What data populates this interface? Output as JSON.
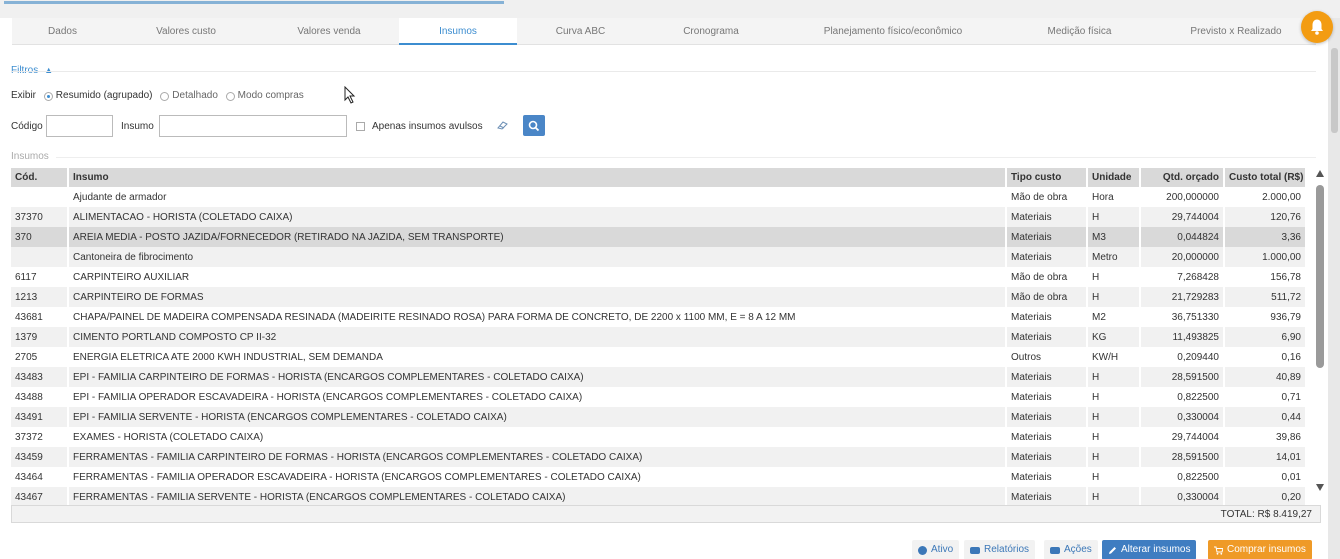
{
  "tabs": [
    {
      "label": "Dados",
      "active": false
    },
    {
      "label": "Valores custo",
      "active": false
    },
    {
      "label": "Valores venda",
      "active": false
    },
    {
      "label": "Insumos",
      "active": true
    },
    {
      "label": "Curva ABC",
      "active": false
    },
    {
      "label": "Cronograma",
      "active": false
    },
    {
      "label": "Planejamento físico/econômico",
      "active": false
    },
    {
      "label": "Medição física",
      "active": false
    },
    {
      "label": "Previsto x Realizado",
      "active": false
    }
  ],
  "colors": {
    "accent": "#3c8dd0",
    "bell": "#f39c12",
    "primary_button": "#3f7dc1",
    "buy_button": "#ef9a27"
  },
  "filters": {
    "title": "Filtros",
    "exibir_label": "Exibir",
    "options": [
      {
        "label": "Resumido (agrupado)",
        "checked": true
      },
      {
        "label": "Detalhado",
        "checked": false
      },
      {
        "label": "Modo compras",
        "checked": false
      }
    ],
    "codigo_label": "Código",
    "codigo_value": "",
    "insumo_label": "Insumo",
    "insumo_value": "",
    "avulsos_label": "Apenas insumos avulsos",
    "avulsos_checked": false
  },
  "grid": {
    "section_title": "Insumos",
    "columns": [
      "Cód.",
      "Insumo",
      "Tipo custo",
      "Unidade",
      "Qtd. orçado",
      "Custo total (R$)"
    ],
    "selected_row": 2,
    "rows": [
      [
        "",
        "Ajudante de armador",
        "Mão de obra",
        "Hora",
        "200,000000",
        "2.000,00"
      ],
      [
        "37370",
        "ALIMENTACAO - HORISTA (COLETADO CAIXA)",
        "Materiais",
        "H",
        "29,744004",
        "120,76"
      ],
      [
        "370",
        "AREIA MEDIA - POSTO JAZIDA/FORNECEDOR (RETIRADO NA JAZIDA, SEM TRANSPORTE)",
        "Materiais",
        "M3",
        "0,044824",
        "3,36"
      ],
      [
        "",
        "Cantoneira de fibrocimento",
        "Materiais",
        "Metro",
        "20,000000",
        "1.000,00"
      ],
      [
        "6117",
        "CARPINTEIRO AUXILIAR",
        "Mão de obra",
        "H",
        "7,268428",
        "156,78"
      ],
      [
        "1213",
        "CARPINTEIRO DE FORMAS",
        "Mão de obra",
        "H",
        "21,729283",
        "511,72"
      ],
      [
        "43681",
        "CHAPA/PAINEL DE MADEIRA COMPENSADA RESINADA (MADEIRITE RESINADO ROSA) PARA FORMA DE CONCRETO, DE 2200 x 1100 MM, E = 8 A 12 MM",
        "Materiais",
        "M2",
        "36,751330",
        "936,79"
      ],
      [
        "1379",
        "CIMENTO PORTLAND COMPOSTO CP II-32",
        "Materiais",
        "KG",
        "11,493825",
        "6,90"
      ],
      [
        "2705",
        "ENERGIA ELETRICA ATE 2000 KWH INDUSTRIAL, SEM DEMANDA",
        "Outros",
        "KW/H",
        "0,209440",
        "0,16"
      ],
      [
        "43483",
        "EPI - FAMILIA CARPINTEIRO DE FORMAS - HORISTA (ENCARGOS COMPLEMENTARES - COLETADO CAIXA)",
        "Materiais",
        "H",
        "28,591500",
        "40,89"
      ],
      [
        "43488",
        "EPI - FAMILIA OPERADOR ESCAVADEIRA - HORISTA (ENCARGOS COMPLEMENTARES - COLETADO CAIXA)",
        "Materiais",
        "H",
        "0,822500",
        "0,71"
      ],
      [
        "43491",
        "EPI - FAMILIA SERVENTE - HORISTA (ENCARGOS COMPLEMENTARES - COLETADO CAIXA)",
        "Materiais",
        "H",
        "0,330004",
        "0,44"
      ],
      [
        "37372",
        "EXAMES - HORISTA (COLETADO CAIXA)",
        "Materiais",
        "H",
        "29,744004",
        "39,86"
      ],
      [
        "43459",
        "FERRAMENTAS - FAMILIA CARPINTEIRO DE FORMAS - HORISTA (ENCARGOS COMPLEMENTARES - COLETADO CAIXA)",
        "Materiais",
        "H",
        "28,591500",
        "14,01"
      ],
      [
        "43464",
        "FERRAMENTAS - FAMILIA OPERADOR ESCAVADEIRA - HORISTA (ENCARGOS COMPLEMENTARES - COLETADO CAIXA)",
        "Materiais",
        "H",
        "0,822500",
        "0,01"
      ],
      [
        "43467",
        "FERRAMENTAS - FAMILIA SERVENTE - HORISTA (ENCARGOS COMPLEMENTARES - COLETADO CAIXA)",
        "Materiais",
        "H",
        "0,330004",
        "0,20"
      ]
    ],
    "total_text": "TOTAL: R$ 8.419,27"
  },
  "actions": [
    {
      "label": "Ativo",
      "icon": "circle-icon",
      "style": "light"
    },
    {
      "label": "Relatórios",
      "icon": "chat-icon",
      "style": "light"
    },
    {
      "label": "Ações",
      "icon": "chat-icon",
      "style": "light"
    },
    {
      "label": "Alterar insumos",
      "icon": "pencil-icon",
      "style": "blue"
    },
    {
      "label": "Comprar insumos",
      "icon": "cart-icon",
      "style": "orange"
    }
  ]
}
